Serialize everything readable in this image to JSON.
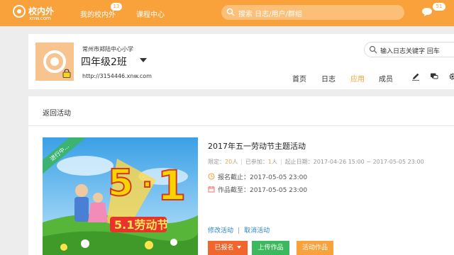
{
  "topbar": {
    "logo_name": "校内外",
    "logo_domain": "xnw.com",
    "nav_my": "我的校内外",
    "nav_my_badge": "13",
    "nav_course": "课程中心",
    "search_placeholder": "搜索 日志/用户/群组",
    "message_badge": "51",
    "color": "#f9a23b"
  },
  "class_header": {
    "school": "常州市郑陆中心小学",
    "class_name": "四年级2班",
    "url": "http://3154446.xnw.com",
    "tabs": [
      "首页",
      "日志",
      "应用",
      "成员"
    ],
    "active_tab": "应用",
    "log_search_placeholder": "输入日志关键字 回车",
    "tool_icons": [
      "pencil-icon",
      "chat-icon",
      "gear-icon"
    ]
  },
  "main": {
    "back_label": "返回活动",
    "activity": {
      "status_banner": "进行中...",
      "title": "2017年五一劳动节主题活动",
      "limit_label": "限定：",
      "limit_value": "20",
      "limit_unit": "人",
      "joined_label": "已参加：",
      "joined_value": "1",
      "joined_unit": "人",
      "date_range": "起止日期：2017-04-26 15:00 ~ 2017-05-05 23:00",
      "signup_deadline": "报名截止：2017-05-05 23:00",
      "works_deadline": "作品截至：2017-05-05 23:00",
      "edit_link": "修改活动",
      "cancel_link": "取消活动",
      "btn_signed": "已报名",
      "btn_upload": "上传作品",
      "btn_works": "活动作品",
      "poster_text": "5.1劳动节"
    }
  }
}
